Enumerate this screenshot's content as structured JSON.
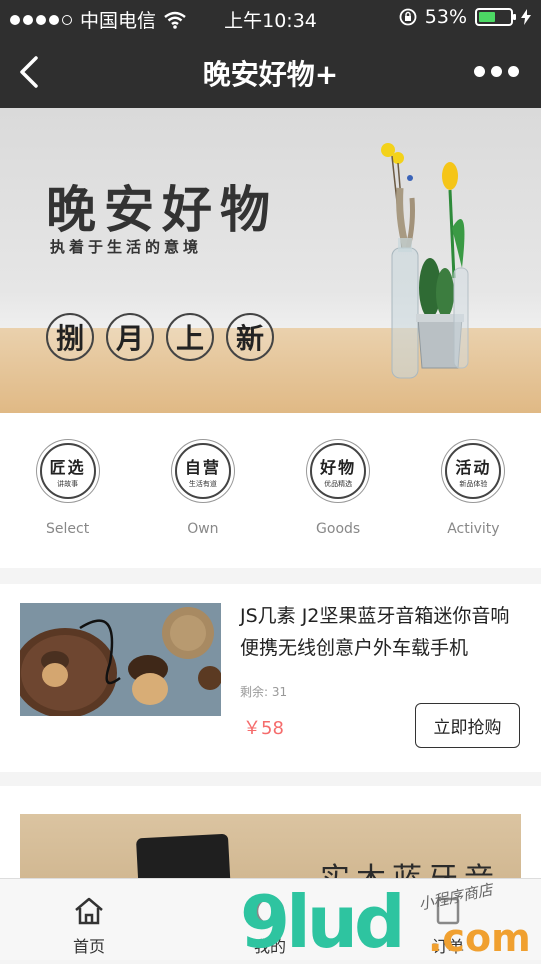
{
  "status_bar": {
    "carrier": "中国电信",
    "time": "上午10:34",
    "battery_percent": "53%",
    "battery_level": 0.53
  },
  "nav": {
    "title": "晚安好物+"
  },
  "banner": {
    "heading": "晚安好物",
    "subheading": "执着于生活的意境",
    "seals": [
      "捌",
      "月",
      "上",
      "新"
    ]
  },
  "categories": [
    {
      "big": "匠选",
      "small": "讲故事",
      "label": "Select"
    },
    {
      "big": "自营",
      "small": "生活有道",
      "label": "Own"
    },
    {
      "big": "好物",
      "small": "优品精选",
      "label": "Goods"
    },
    {
      "big": "活动",
      "small": "新品体验",
      "label": "Activity"
    }
  ],
  "product": {
    "name": "JS几素 J2坚果蓝牙音箱迷你音响便携无线创意户外车载手机",
    "stock": "剩余: 31",
    "price": "￥58",
    "buy_label": "立即抢购"
  },
  "product2": {
    "image_text": "实木蓝牙音箱"
  },
  "tabbar": {
    "tabs": [
      {
        "label": "首页"
      },
      {
        "label": "我的"
      },
      {
        "label": "订单"
      }
    ]
  },
  "watermark": {
    "logo": "9lud",
    "suffix": ".com",
    "handwriting": "小程序商店"
  },
  "colors": {
    "header_bg": "#2f2f2f",
    "price": "#f56c6c",
    "battery": "#4cd964"
  }
}
